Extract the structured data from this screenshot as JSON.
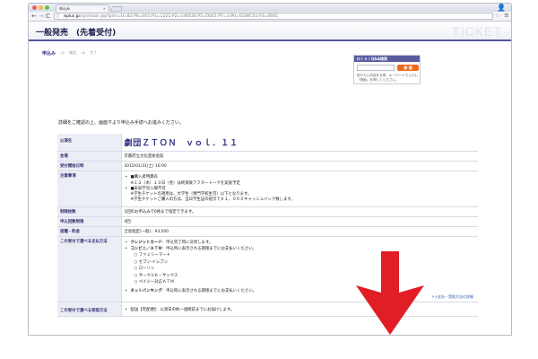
{
  "browser": {
    "tab_title": "申込み",
    "tab_close": "×",
    "url_host": "eplus.jp",
    "url_path": "/sys/main.jsp?prm=U=82:P6=001:P1=1221:P2=146430:P5=0001:P7=1:P0=GGWC01:P3=0001",
    "back": "←",
    "forward": "→",
    "reload": "C",
    "star": "☆",
    "menu": "≡",
    "profile": "👤"
  },
  "header": {
    "title": "一般発売　(先着受付)",
    "logo": "TICKET"
  },
  "steps": [
    {
      "label": "申込み"
    },
    {
      "label": "確認"
    },
    {
      "label": "完了"
    }
  ],
  "qa": {
    "title": "ｍｉｎｉQ&A検索",
    "search_button": "検 索",
    "note": "知りたい内容を文章、キーワードで入力し「検索」を押してください。"
  },
  "intro": "詳細をご確認の上、画面下より申込み手続へお進みください。",
  "table": {
    "r1": {
      "label": "公演名",
      "value": "劇団ＺＴＯＮ　ｖｏｌ．１１"
    },
    "r2": {
      "label": "会場",
      "value": "京都府立文化芸術会館"
    },
    "r3": {
      "label": "受付開始日時",
      "value": "2015/01/31(土) 10:00"
    },
    "r4": {
      "label": "注意事項",
      "b1": "■購入者特典有",
      "b1_sub": "※１２（木）１３日（金）は終演後アフタートークを実施予定",
      "b2": "■未就学児入場不可",
      "b2_sub1": "※学生チケットの適用は、大学生（専門学校生可）以下となります。",
      "b2_sub2": "※学生チケットご購入の方は、当日学生証の提示で￥１，０００キャッシュバック致します。"
    },
    "r5": {
      "label": "制限枚数",
      "value": "1回のお申込みで6枚まで指定できます。"
    },
    "r6": {
      "label": "申込回数制限",
      "value": "4回"
    },
    "r7": {
      "label": "席種・料金",
      "value": "全席指定(一般)：¥3,500"
    },
    "r8": {
      "label": "この受付で選べる支払方法",
      "p1_b": "クレジットカード",
      "p1": "：申込完了時に決済します。",
      "p2_b": "コンビニ／ＡＴＭ",
      "p2": "：申込時に表示される期限までにお支払いください。",
      "opts": [
        "ファミリーマート",
        "セブン-イレブン",
        "ローソン",
        "サークルＫ・サンクス",
        "ペイジー対応ＡＴＭ"
      ],
      "p3_b": "ネットバンキング",
      "p3": "：申込時に表示される期限までにお支払いください。",
      "link": ">>支払・受取方法の詳細"
    },
    "r9": {
      "label": "この受付で選べる受取方法",
      "r1": "配送【宅配便】：公演日の約一週間前までにお届けします。"
    }
  },
  "colors": {
    "accent": "#2d2f80",
    "arrow": "#e11d26",
    "search": "#ea6a1e"
  }
}
